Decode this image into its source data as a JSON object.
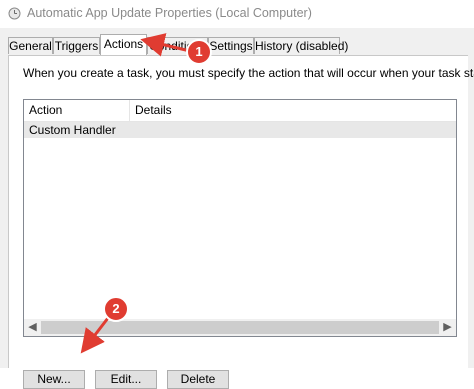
{
  "window": {
    "title": "Automatic App Update Properties (Local Computer)",
    "icon": "clock-icon"
  },
  "tabs": [
    {
      "label": "General",
      "active": false
    },
    {
      "label": "Triggers",
      "active": false
    },
    {
      "label": "Actions",
      "active": true
    },
    {
      "label": "Conditions",
      "active": false
    },
    {
      "label": "Settings",
      "active": false
    },
    {
      "label": "History (disabled)",
      "active": false
    }
  ],
  "panel": {
    "instructions": "When you create a task, you must specify the action that will occur when your task starts."
  },
  "list": {
    "columns": [
      "Action",
      "Details"
    ],
    "rows": [
      {
        "action": "Custom Handler",
        "details": ""
      }
    ]
  },
  "buttons": {
    "new": "New...",
    "edit": "Edit...",
    "delete": "Delete"
  },
  "annotations": {
    "badge1": "1",
    "badge2": "2",
    "color": "#e03c31"
  }
}
